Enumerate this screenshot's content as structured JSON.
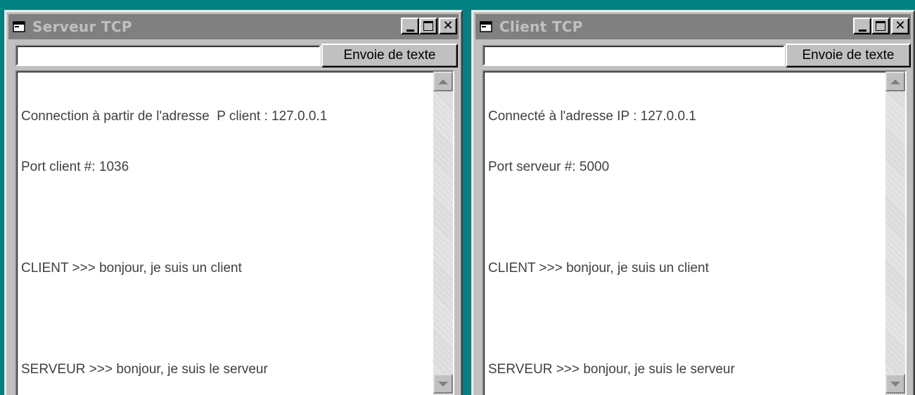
{
  "colors": {
    "desktop": "#008080",
    "titlebar_inactive": "#808080",
    "face": "#c0c0c0"
  },
  "server_window": {
    "title": "Serveur TCP",
    "icon": "window-app-icon",
    "input_value": "",
    "send_label": "Envoie de texte",
    "log": [
      "Connection à partir de l'adresse  P client : 127.0.0.1",
      "Port client #: 1036",
      "",
      "CLIENT >>> bonjour, je suis un client",
      "",
      "SERVEUR >>> bonjour, je suis le serveur"
    ]
  },
  "client_window": {
    "title": "Client TCP",
    "icon": "window-app-icon",
    "input_value": "",
    "send_label": "Envoie de texte",
    "log": [
      "Connecté à l'adresse IP : 127.0.0.1",
      "Port serveur #: 5000",
      "",
      "CLIENT >>> bonjour, je suis un client",
      "",
      "SERVEUR >>> bonjour, je suis le serveur"
    ]
  }
}
